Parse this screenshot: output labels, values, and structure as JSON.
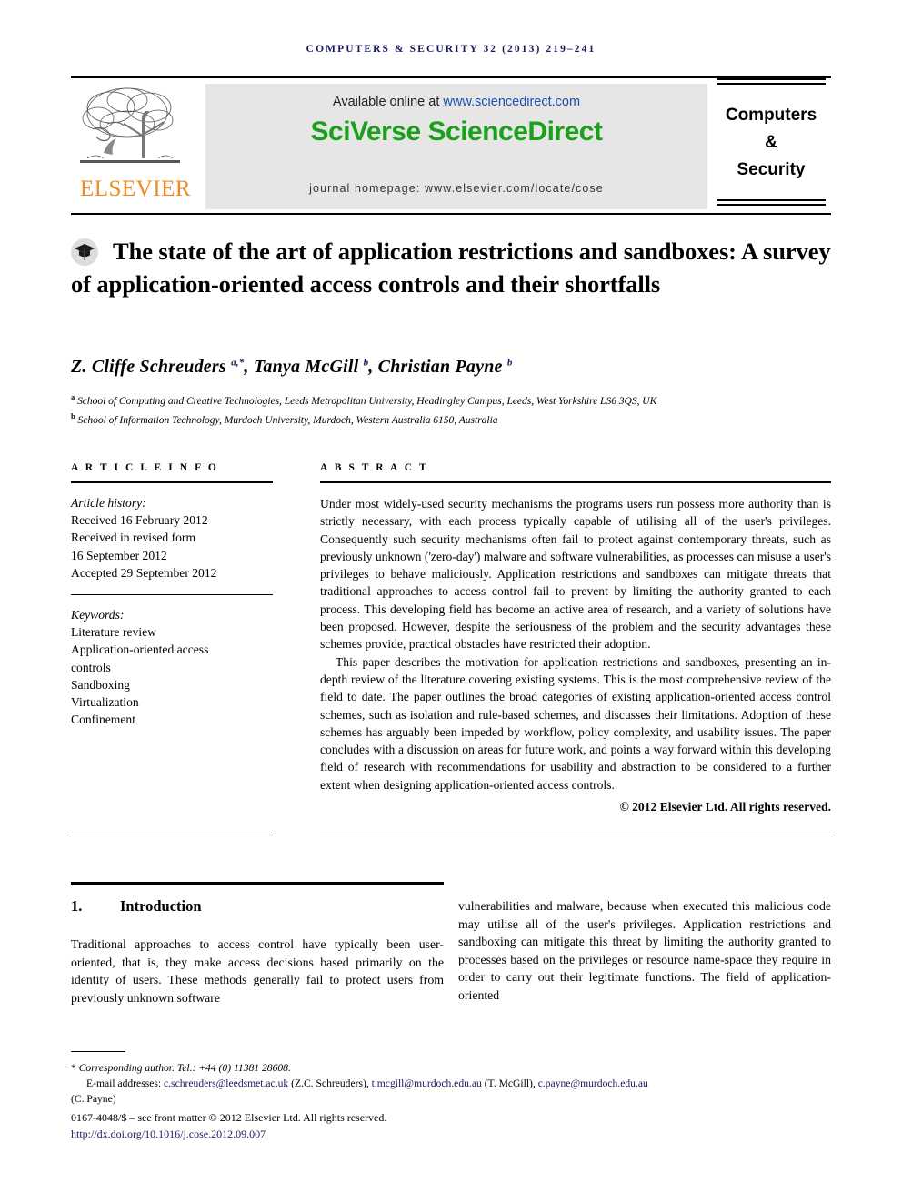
{
  "running_head": "COMPUTERS & SECURITY 32 (2013) 219–241",
  "masthead": {
    "publisher_name": "ELSEVIER",
    "publisher_logo_icon": "elsevier-tree-icon",
    "available_prefix": "Available online at ",
    "available_url": "www.sciencedirect.com",
    "sciencedirect_logo": "SciVerse ScienceDirect",
    "journal_homepage": "journal homepage: www.elsevier.com/locate/cose",
    "journal_cover_line1": "Computers",
    "journal_cover_line2": "&",
    "journal_cover_line3": "Security",
    "band_color": "#E6E6E6",
    "sciencedirect_color": "#1CA01C",
    "elsevier_color": "#F08A1E",
    "link_color": "#1c4fb0"
  },
  "article": {
    "crossmark_icon": "graduation-cap-icon",
    "title": "The state of the art of application restrictions and sandboxes: A survey of application-oriented access controls and their shortfalls",
    "authors_html": "Z. Cliffe Schreuders <sup>a,*</sup>, Tanya McGill <sup>b</sup>, Christian Payne <sup>b</sup>",
    "affiliations": [
      {
        "marker": "a",
        "text": "School of Computing and Creative Technologies, Leeds Metropolitan University, Headingley Campus, Leeds, West Yorkshire LS6 3QS, UK"
      },
      {
        "marker": "b",
        "text": "School of Information Technology, Murdoch University, Murdoch, Western Australia 6150, Australia"
      }
    ]
  },
  "article_info": {
    "heading": "A R T I C L E  I N F O",
    "history_label": "Article history:",
    "history": [
      "Received 16 February 2012",
      "Received in revised form",
      "16 September 2012",
      "Accepted 29 September 2012"
    ],
    "keywords_label": "Keywords:",
    "keywords": [
      "Literature review",
      "Application-oriented access",
      "controls",
      "Sandboxing",
      "Virtualization",
      "Confinement"
    ]
  },
  "abstract": {
    "heading": "A B S T R A C T",
    "paragraph1": "Under most widely-used security mechanisms the programs users run possess more authority than is strictly necessary, with each process typically capable of utilising all of the user's privileges. Consequently such security mechanisms often fail to protect against contemporary threats, such as previously unknown ('zero-day') malware and software vulnerabilities, as processes can misuse a user's privileges to behave maliciously. Application restrictions and sandboxes can mitigate threats that traditional approaches to access control fail to prevent by limiting the authority granted to each process. This developing field has become an active area of research, and a variety of solutions have been proposed. However, despite the seriousness of the problem and the security advantages these schemes provide, practical obstacles have restricted their adoption.",
    "paragraph2": "This paper describes the motivation for application restrictions and sandboxes, presenting an in-depth review of the literature covering existing systems. This is the most comprehensive review of the field to date. The paper outlines the broad categories of existing application-oriented access control schemes, such as isolation and rule-based schemes, and discusses their limitations. Adoption of these schemes has arguably been impeded by workflow, policy complexity, and usability issues. The paper concludes with a discussion on areas for future work, and points a way forward within this developing field of research with recommendations for usability and abstraction to be considered to a further extent when designing application-oriented access controls.",
    "copyright": "© 2012 Elsevier Ltd. All rights reserved."
  },
  "body": {
    "section_number": "1.",
    "section_title": "Introduction",
    "left_text": "Traditional approaches to access control have typically been user-oriented, that is, they make access decisions based primarily on the identity of users. These methods generally fail to protect users from previously unknown software",
    "right_text": "vulnerabilities and malware, because when executed this malicious code may utilise all of the user's privileges. Application restrictions and sandboxing can mitigate this threat by limiting the authority granted to processes based on the privileges or resource name-space they require in order to carry out their legitimate functions. The field of application-oriented"
  },
  "footnotes": {
    "corresponding": "Corresponding author. Tel.: +44 (0) 11381 28608.",
    "corresponding_star": "*",
    "emails_label": "E-mail addresses:",
    "emails": [
      {
        "address": "c.schreuders@leedsmet.ac.uk",
        "owner": "(Z.C. Schreuders)"
      },
      {
        "address": "t.mcgill@murdoch.edu.au",
        "owner": "(T. McGill)"
      },
      {
        "address": "c.payne@murdoch.edu.au",
        "owner": "(C. Payne)"
      }
    ],
    "front_matter": "0167-4048/$ – see front matter © 2012 Elsevier Ltd. All rights reserved.",
    "doi": "http://dx.doi.org/10.1016/j.cose.2012.09.007",
    "link_color": "#181860"
  }
}
